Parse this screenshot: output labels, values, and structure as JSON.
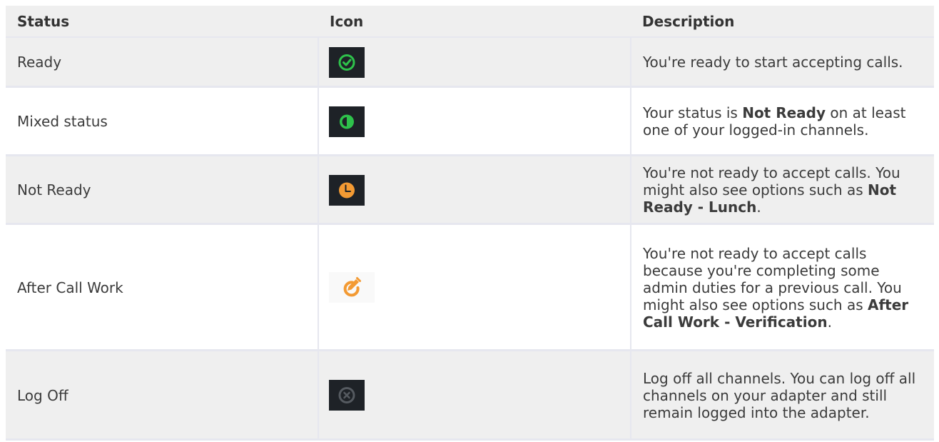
{
  "table": {
    "headers": {
      "status": "Status",
      "icon": "Icon",
      "description": "Description"
    },
    "rows": [
      {
        "status": "Ready",
        "icon": "ready-check-icon",
        "desc_before": "You're ready to start accepting calls.",
        "desc_bold": "",
        "desc_after": ""
      },
      {
        "status": "Mixed status",
        "icon": "mixed-status-half-circle-icon",
        "desc_before": "Your status is ",
        "desc_bold": "Not Ready",
        "desc_after": " on at least one of your logged-in channels."
      },
      {
        "status": "Not Ready",
        "icon": "not-ready-clock-icon",
        "desc_before": "You're not ready to accept calls. You might also see options such as ",
        "desc_bold": "Not Ready - Lunch",
        "desc_after": "."
      },
      {
        "status": "After Call Work",
        "icon": "after-call-work-pencil-icon",
        "desc_before": "You're not ready to accept calls because you're completing some admin duties for a previous call. You might also see options such as ",
        "desc_bold": "After Call Work - Verification",
        "desc_after": "."
      },
      {
        "status": "Log Off",
        "icon": "log-off-x-icon",
        "desc_before": "Log off all channels. You can log off all channels on your adapter and still remain logged into the adapter.",
        "desc_bold": "",
        "desc_after": ""
      }
    ]
  },
  "colors": {
    "ready_green": "#2ec24b",
    "not_ready_orange": "#f39a33",
    "icon_background": "#1e2227",
    "log_off_grey": "#555a60",
    "row_alt_background": "#efefef",
    "border": "#e6e7ef"
  }
}
